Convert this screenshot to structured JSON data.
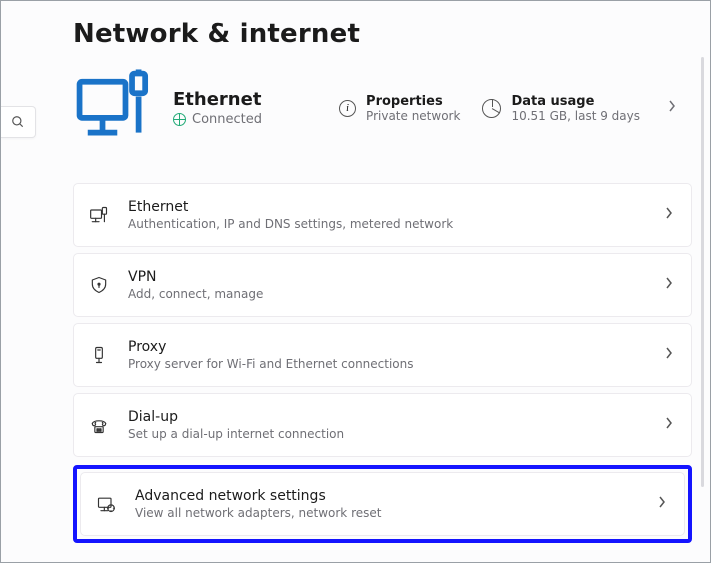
{
  "title": "Network & internet",
  "hero": {
    "name": "Ethernet",
    "status": "Connected",
    "properties_label": "Properties",
    "properties_sub": "Private network",
    "usage_label": "Data usage",
    "usage_sub": "10.51 GB, last 9 days"
  },
  "items": [
    {
      "icon": "ethernet",
      "title": "Ethernet",
      "sub": "Authentication, IP and DNS settings, metered network"
    },
    {
      "icon": "vpn",
      "title": "VPN",
      "sub": "Add, connect, manage"
    },
    {
      "icon": "proxy",
      "title": "Proxy",
      "sub": "Proxy server for Wi-Fi and Ethernet connections"
    },
    {
      "icon": "dialup",
      "title": "Dial-up",
      "sub": "Set up a dial-up internet connection"
    },
    {
      "icon": "advanced",
      "title": "Advanced network settings",
      "sub": "View all network adapters, network reset"
    }
  ],
  "highlight_index": 4
}
